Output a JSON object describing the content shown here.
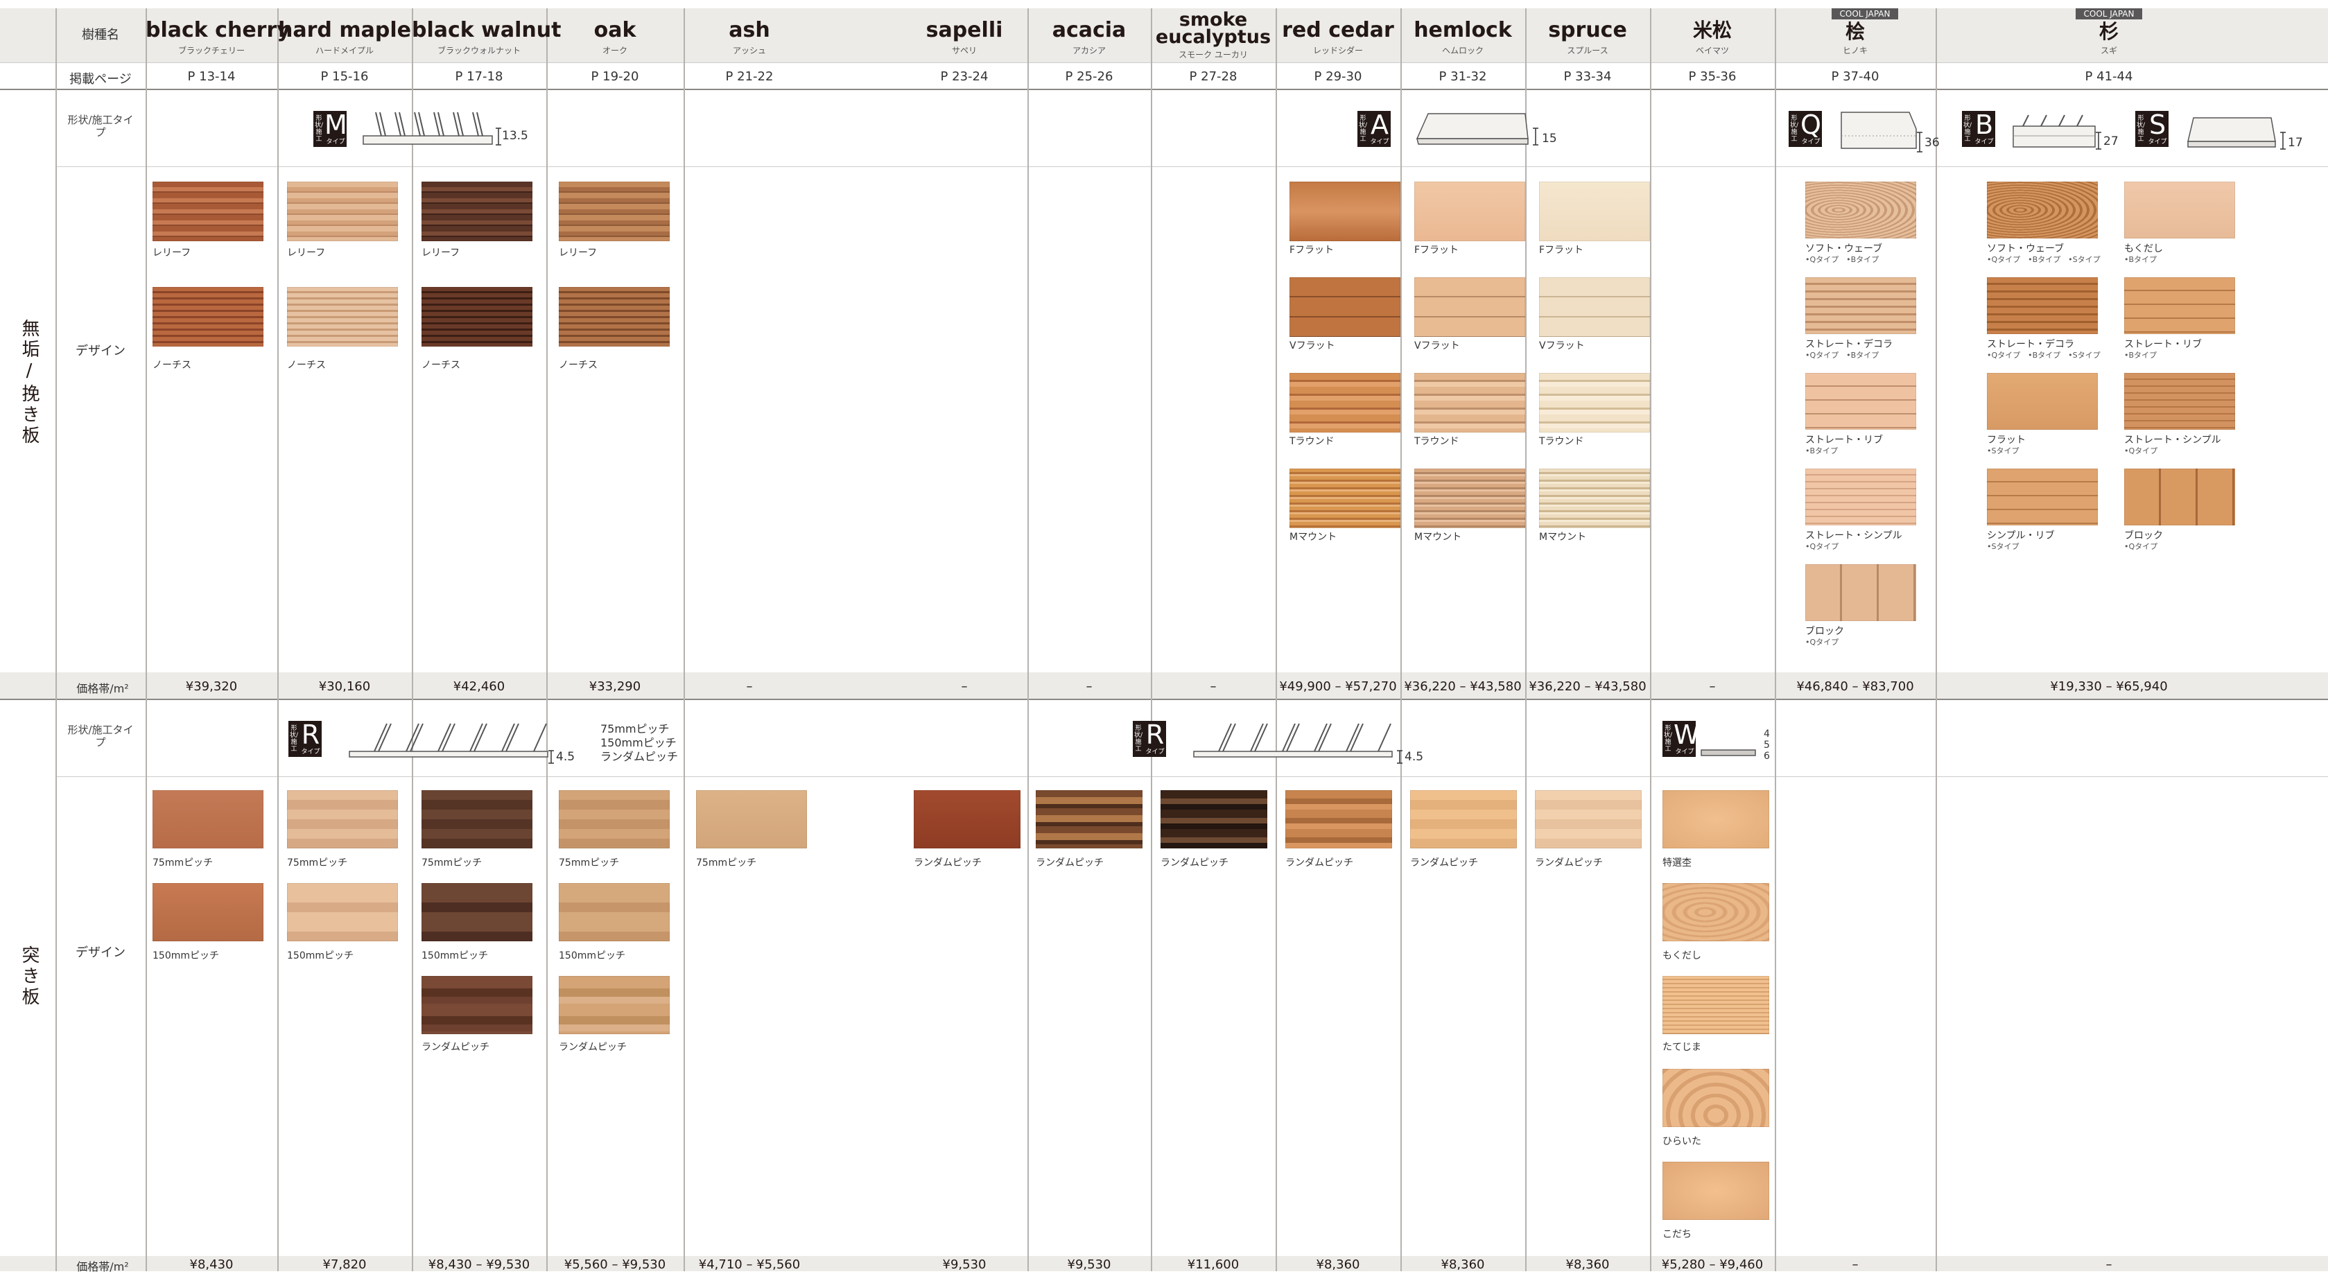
{
  "header": {
    "species_label": "樹種名",
    "page_label": "掲載ページ",
    "cool_japan": "COOL JAPAN",
    "species": [
      {
        "en": "black cherry",
        "ja": "ブラックチェリー",
        "page": "P 13-14"
      },
      {
        "en": "hard maple",
        "ja": "ハードメイプル",
        "page": "P 15-16"
      },
      {
        "en": "black walnut",
        "ja": "ブラックウォルナット",
        "page": "P 17-18"
      },
      {
        "en": "oak",
        "ja": "オーク",
        "page": "P 19-20"
      },
      {
        "en": "ash",
        "ja": "アッシュ",
        "page": "P 21-22"
      },
      {
        "en": "sapelli",
        "ja": "サペリ",
        "page": "P 23-24"
      },
      {
        "en": "acacia",
        "ja": "アカシア",
        "page": "P 25-26"
      },
      {
        "en": "smoke eucalyptus",
        "ja": "スモーク ユーカリ",
        "page": "P 27-28"
      },
      {
        "en": "red cedar",
        "ja": "レッドシダー",
        "page": "P 29-30"
      },
      {
        "en": "hemlock",
        "ja": "ヘムロック",
        "page": "P 31-32"
      },
      {
        "en": "spruce",
        "ja": "スプルース",
        "page": "P 33-34"
      },
      {
        "en": "米松",
        "ja": "ベイマツ",
        "page": "P 35-36"
      },
      {
        "en": "桧",
        "ja": "ヒノキ",
        "page": "P 37-40"
      },
      {
        "en": "杉",
        "ja": "スギ",
        "page": "P 41-44"
      }
    ]
  },
  "labels": {
    "shape_type": "形状/施工タイプ",
    "design": "デザイン",
    "price_band": "価格帯/m²",
    "badge_kanji": "形状/施工",
    "badge_type": "タイプ"
  },
  "section1": {
    "title": "無垢/挽き板",
    "type_m": {
      "letter": "M",
      "dim": "13.5"
    },
    "type_a": {
      "letter": "A",
      "dim": "15"
    },
    "type_q": {
      "letter": "Q",
      "dim": "36"
    },
    "type_b": {
      "letter": "B",
      "dim": "27"
    },
    "type_s": {
      "letter": "S",
      "dim": "17"
    },
    "caps": {
      "leaf": "レリーフ",
      "notch": "ノーチス",
      "fflat": "Fフラット",
      "vflat": "Vフラット",
      "tround": "Tラウンド",
      "mmount": "Mマウント",
      "softwave": "ソフト・ウェーブ",
      "straightdeco": "ストレート・デコラ",
      "straightrib": "ストレート・リブ",
      "straightsimple": "ストレート・シンプル",
      "block": "ブロック",
      "mokudashi": "もくだし",
      "flat": "フラット",
      "simplerib": "シンプル・リブ"
    },
    "subs": {
      "qb": "•Qタイプ　•Bタイプ",
      "qbs": "•Qタイプ　•Bタイプ　•Sタイプ",
      "b": "•Bタイプ",
      "q": "•Qタイプ",
      "s": "•Sタイプ"
    },
    "prices": [
      "¥39,320",
      "¥30,160",
      "¥42,460",
      "¥33,290",
      "–",
      "–",
      "–",
      "–",
      "¥49,900 – ¥57,270",
      "¥36,220 – ¥43,580",
      "¥36,220 – ¥43,580",
      "–",
      "¥46,840 – ¥83,700",
      "¥19,330 – ¥65,940"
    ]
  },
  "section2": {
    "title": "突き板",
    "type_r": {
      "letter": "R",
      "dim": "4.5",
      "pitches": [
        "75mmピッチ",
        "150mmピッチ",
        "ランダムピッチ"
      ]
    },
    "type_w": {
      "letter": "W",
      "dims": [
        "4",
        "5",
        "6"
      ]
    },
    "caps": {
      "p75": "75mmピッチ",
      "p150": "150mmピッチ",
      "random": "ランダムピッチ",
      "tokusen": "特選杢",
      "mokudashi": "もくだし",
      "tatejima": "たてじま",
      "hiraita": "ひらいた",
      "kodachi": "こだち"
    },
    "prices": [
      "¥8,430",
      "¥7,820",
      "¥8,430 – ¥9,530",
      "¥5,560 – ¥9,530",
      "¥4,710 – ¥5,560",
      "¥9,530",
      "¥9,530",
      "¥11,600",
      "¥8,360",
      "¥8,360",
      "¥8,360",
      "¥5,280 – ¥9,460",
      "–",
      "–"
    ]
  },
  "colors": {
    "header_band": "#ecebe8",
    "text": "#231815",
    "badge": "#231815"
  }
}
